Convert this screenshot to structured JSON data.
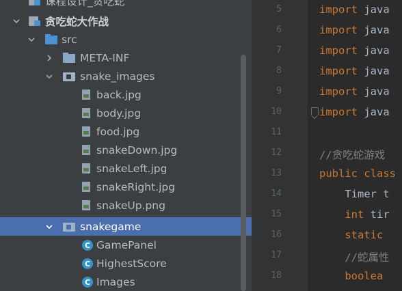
{
  "project_tree": {
    "items": [
      {
        "label": "课程设计_贪吃蛇",
        "kind": "module-partial",
        "expanded": true
      },
      {
        "label": "贪吃蛇大作战",
        "kind": "module",
        "expanded": true
      },
      {
        "label": "src",
        "kind": "src-folder",
        "expanded": true
      },
      {
        "label": "META-INF",
        "kind": "folder",
        "expanded": false
      },
      {
        "label": "snake_images",
        "kind": "package",
        "expanded": true
      },
      {
        "label": "back.jpg",
        "kind": "image"
      },
      {
        "label": "body.jpg",
        "kind": "image"
      },
      {
        "label": "food.jpg",
        "kind": "image"
      },
      {
        "label": "snakeDown.jpg",
        "kind": "image"
      },
      {
        "label": "snakeLeft.jpg",
        "kind": "image"
      },
      {
        "label": "snakeRight.jpg",
        "kind": "image"
      },
      {
        "label": "snakeUp.png",
        "kind": "image"
      },
      {
        "label": "snakegame",
        "kind": "package",
        "expanded": true,
        "selected": true
      },
      {
        "label": "GamePanel",
        "kind": "class"
      },
      {
        "label": "HighestScore",
        "kind": "class"
      },
      {
        "label": "Images",
        "kind": "class"
      }
    ]
  },
  "editor": {
    "line_numbers": [
      "5",
      "6",
      "7",
      "8",
      "9",
      "10",
      "11",
      "12",
      "13",
      "14",
      "15",
      "16",
      "17",
      "18"
    ],
    "lines": [
      {
        "kw": "import",
        "text": " java"
      },
      {
        "kw": "import",
        "text": " java"
      },
      {
        "kw": "import",
        "text": " java"
      },
      {
        "kw": "import",
        "text": " java"
      },
      {
        "kw": "import",
        "text": " java"
      },
      {
        "kw": "import",
        "text": " java"
      },
      {
        "kw": "",
        "text": ""
      },
      {
        "comment": "//贪吃蛇游戏"
      },
      {
        "kw": "public class",
        "text": ""
      },
      {
        "kw": "",
        "text": "    Timer t"
      },
      {
        "kw": "    int",
        "text": " tir"
      },
      {
        "kw": "    static",
        "text": ""
      },
      {
        "comment": "    //蛇属性"
      },
      {
        "kw": "    boolea",
        "text": ""
      }
    ]
  },
  "colors": {
    "tree_bg": "#3c3f41",
    "selection": "#4b6eaf",
    "editor_bg": "#2b2b2b",
    "keyword": "#cc7832",
    "comment": "#808080",
    "class_icon": "#3592c4"
  }
}
